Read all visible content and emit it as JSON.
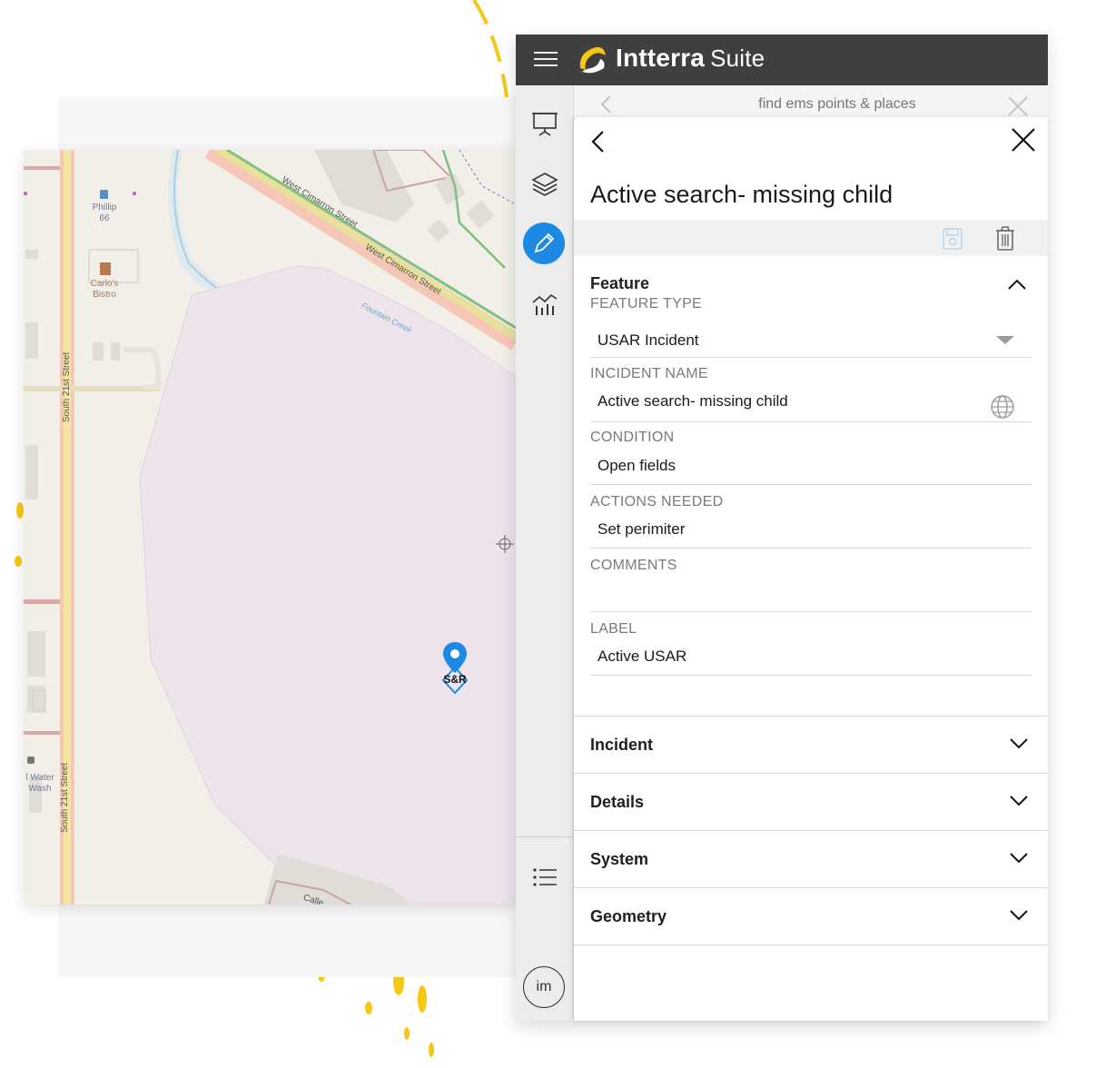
{
  "app": {
    "brand_name": "Intterra",
    "brand_suffix": "Suite",
    "accent_color": "#1e88e5",
    "topbar_color": "#3f3f3f"
  },
  "rail": {
    "items": [
      "presentation-icon",
      "layers-icon",
      "edit-pencil-icon",
      "analytics-chart-icon",
      "list-icon"
    ],
    "active": "edit-pencil-icon",
    "avatar_initials": "im"
  },
  "search": {
    "placeholder": "find ems points & places"
  },
  "panel": {
    "title": "Active search- missing child",
    "feature_section": {
      "title": "Feature",
      "fields": {
        "feature_type_label": "FEATURE TYPE",
        "feature_type_value": "USAR Incident",
        "incident_name_label": "INCIDENT NAME",
        "incident_name_value": "Active search- missing child",
        "condition_label": "CONDITION",
        "condition_value": "Open fields",
        "actions_label": "ACTIONS NEEDED",
        "actions_value": "Set perimiter",
        "comments_label": "COMMENTS",
        "comments_value": "",
        "label_label": "LABEL",
        "label_value": "Active USAR"
      }
    },
    "collapsed_sections": [
      "Incident",
      "Details",
      "System",
      "Geometry"
    ]
  },
  "map": {
    "labels": {
      "poi_phillip": "Phillip\n66",
      "poi_carlos": "Carlo's\nBistro",
      "poi_water": "l Water\nWash",
      "street_cimarron_1": "West Cimarron Street",
      "street_cimarron_2": "West Cimarron Street",
      "creek": "Fountain Creek",
      "street_21st_1": "South 21st Street",
      "street_21st_2": "South 21st Street",
      "street_bottom": "Calle",
      "marker_text": "S&R"
    }
  }
}
